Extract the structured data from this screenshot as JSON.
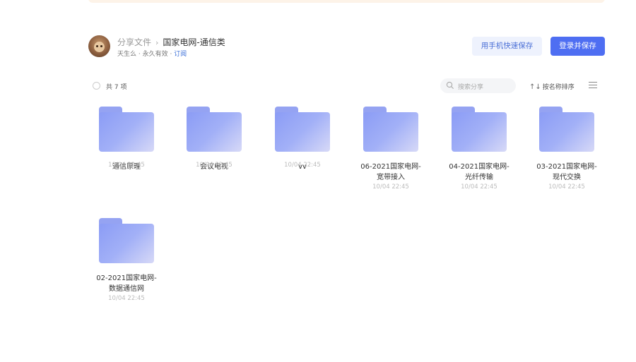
{
  "header": {
    "breadcrumb_root": "分享文件",
    "breadcrumb_current": "国家电网-通信类",
    "meta_text": "天生么 · 永久有效 · ",
    "subscribe_label": "订阅",
    "phone_save_label": "用手机快速保存",
    "login_save_label": "登录并保存"
  },
  "toolbar": {
    "count_label": "共 7 项",
    "search_placeholder": "搜索分享",
    "sort_label": "按名称排序",
    "sort_icon": "↑↓"
  },
  "files": [
    {
      "name_line1": "通信原理",
      "name_line2": "",
      "date": "10/04 22:45"
    },
    {
      "name_line1": "会议电视",
      "name_line2": "",
      "date": "10/04 22:45"
    },
    {
      "name_line1": "vv",
      "name_line2": "",
      "date": "10/04 22:45"
    },
    {
      "name_line1": "06-2021国家电网-",
      "name_line2": "宽带接入",
      "date": "10/04 22:45"
    },
    {
      "name_line1": "04-2021国家电网-",
      "name_line2": "光纤传输",
      "date": "10/04 22:45"
    },
    {
      "name_line1": "03-2021国家电网-",
      "name_line2": "现代交换",
      "date": "10/04 22:45"
    },
    {
      "name_line1": "02-2021国家电网-",
      "name_line2": "数据通信网",
      "date": "10/04 22:45"
    }
  ],
  "colors": {
    "accent": "#4e6ef2",
    "folder_light": "#d7d9f7",
    "folder_dark": "#8b9cf5",
    "banner": "#fdf3e8"
  },
  "icons": [
    "search-icon",
    "sort-icon",
    "list-view-icon",
    "folder-icon"
  ]
}
